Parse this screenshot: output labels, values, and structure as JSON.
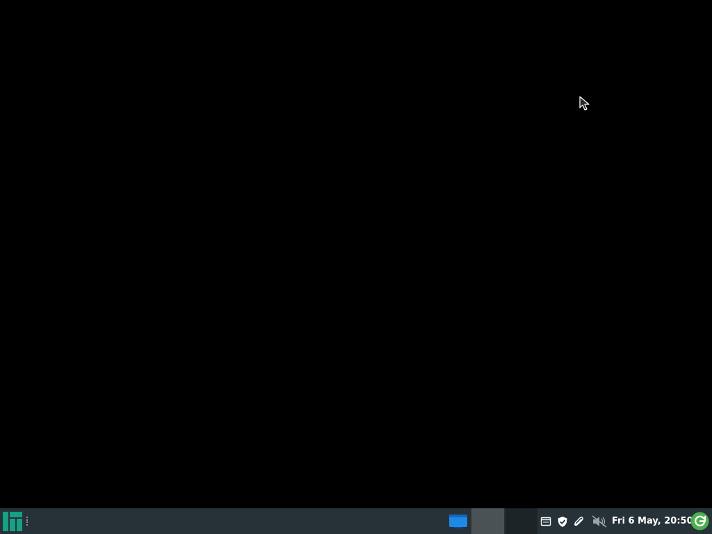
{
  "desktop": {
    "background_color": "#000000"
  },
  "panel": {
    "background_color": "#263238",
    "start_menu_icon": "manjaro-logo-icon",
    "start_menu_color": "#16a085",
    "handle_icon": "panel-handle-icon",
    "workspaces": [
      {
        "icon": "window-icon",
        "color": "#1e88e5"
      },
      {
        "state": "active"
      },
      {
        "state": "inactive"
      }
    ],
    "tray": [
      {
        "icon": "clipboard-icon"
      },
      {
        "icon": "shield-check-icon"
      },
      {
        "icon": "paperclip-icon"
      },
      {
        "icon": "volume-muted-icon"
      }
    ],
    "clock_text": "Fri  6 May, 20:50",
    "update_icon": "update-refresh-icon",
    "update_color": "#4caf50"
  }
}
